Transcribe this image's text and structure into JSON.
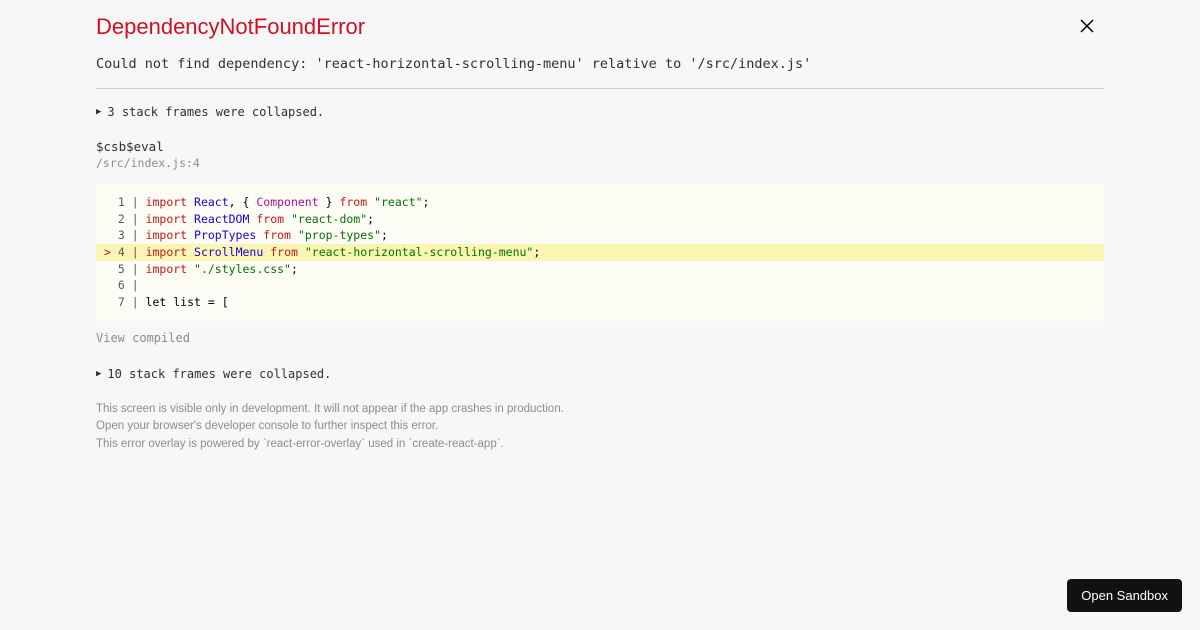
{
  "error": {
    "title": "DependencyNotFoundError",
    "message": "Could not find dependency: 'react-horizontal-scrolling-menu' relative to '/src/index.js'"
  },
  "collapse_top": "3 stack frames were collapsed.",
  "frame": {
    "name": "$csb$eval",
    "location": "/src/index.js:4"
  },
  "code": {
    "l1": {
      "n": "  1 | ",
      "kw": "import",
      "v": " React",
      "c1": ", { ",
      "cls": "Component",
      "c2": " } ",
      "fr": "from",
      "sp": " ",
      "str": "\"react\"",
      "end": ";"
    },
    "l2": {
      "n": "  2 | ",
      "kw": "import",
      "v": " ReactDOM",
      "sp": " ",
      "fr": "from",
      "sp2": " ",
      "str": "\"react-dom\"",
      "end": ";"
    },
    "l3": {
      "n": "  3 | ",
      "kw": "import",
      "v": " PropTypes",
      "sp": " ",
      "fr": "from",
      "sp2": " ",
      "str": "\"prop-types\"",
      "end": ";"
    },
    "l4": {
      "p": "> ",
      "n": "4 | ",
      "kw": "import",
      "v": " ScrollMenu",
      "sp": " ",
      "fr": "from",
      "sp2": " ",
      "str": "\"react-horizontal-scrolling-menu\"",
      "end": ";"
    },
    "l5": {
      "n": "  5 | ",
      "kw": "import",
      "sp": " ",
      "str": "\"./styles.css\"",
      "end": ";"
    },
    "l6": {
      "n": "  6 | "
    },
    "l7": {
      "n": "  7 | ",
      "txt": "let list = ["
    }
  },
  "view_compiled": "View compiled",
  "collapse_bottom": "10 stack frames were collapsed.",
  "hints": {
    "a": "This screen is visible only in development. It will not appear if the app crashes in production.",
    "b": "Open your browser's developer console to further inspect this error.",
    "c": "This error overlay is powered by `react-error-overlay` used in `create-react-app`."
  },
  "open_sandbox": "Open Sandbox"
}
